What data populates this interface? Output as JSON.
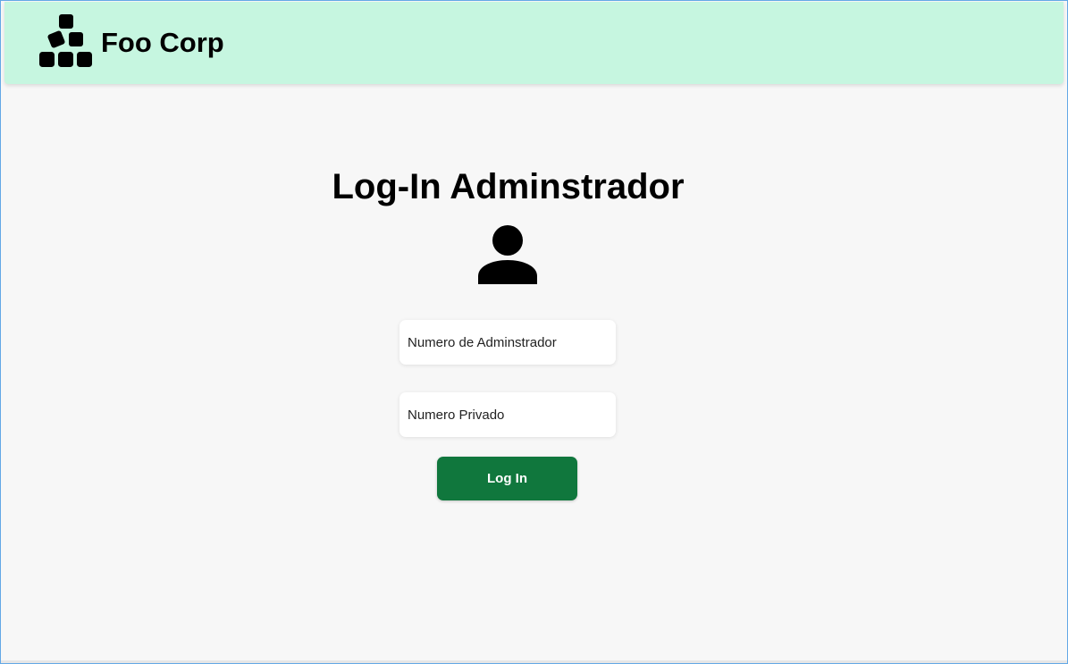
{
  "header": {
    "brand_name": "Foo Corp",
    "logo_icon": "boxes-stack-icon",
    "background_color": "#c6f6e0"
  },
  "login": {
    "title": "Log-In Adminstrador",
    "avatar_icon": "user-icon",
    "admin_number_placeholder": "Numero de Adminstrador",
    "private_number_placeholder": "Numero Privado",
    "submit_label": "Log In",
    "submit_color": "#10773d"
  }
}
